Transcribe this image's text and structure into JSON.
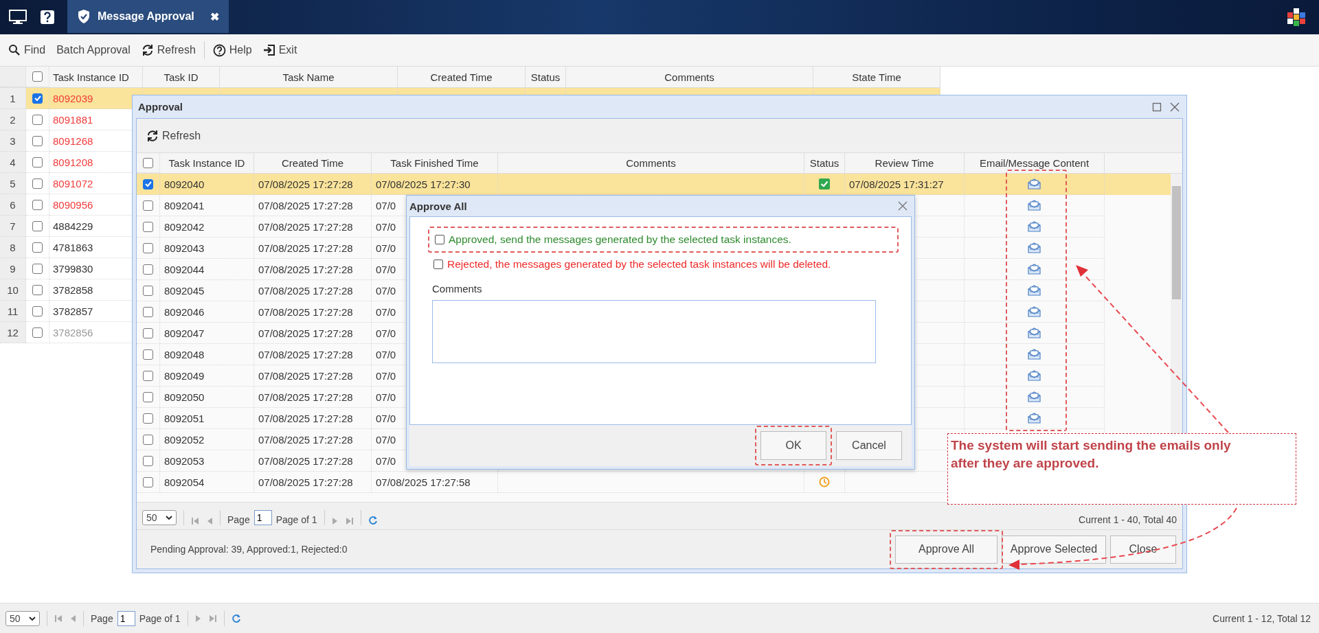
{
  "top_bar": {
    "tab": {
      "title": "Message Approval",
      "close": "✖",
      "selected": true
    }
  },
  "toolbar": [
    {
      "label": "Find",
      "kind": "search",
      "separator_before": false
    },
    {
      "label": "Batch Approval",
      "kind": "plain",
      "separator_before": false
    },
    {
      "label": "Refresh",
      "kind": "refresh",
      "separator_before": false
    },
    {
      "label": "Help",
      "kind": "help",
      "separator_before": true
    },
    {
      "label": "Exit",
      "kind": "exit",
      "separator_before": false
    }
  ],
  "main_grid": {
    "header_checked": false,
    "columns": [
      "Task Instance ID",
      "Task ID",
      "Task Name",
      "Created Time",
      "Status",
      "Comments",
      "State Time"
    ],
    "rows": [
      {
        "number": "1",
        "checked": true,
        "selected": true,
        "task_instance_id": "8092039",
        "color": "#f03a3a"
      },
      {
        "number": "2",
        "checked": false,
        "selected": false,
        "task_instance_id": "8091881",
        "color": "#f03a3a"
      },
      {
        "number": "3",
        "checked": false,
        "selected": false,
        "task_instance_id": "8091268",
        "color": "#f03a3a"
      },
      {
        "number": "4",
        "checked": false,
        "selected": false,
        "task_instance_id": "8091208",
        "color": "#f03a3a"
      },
      {
        "number": "5",
        "checked": false,
        "selected": false,
        "task_instance_id": "8091072",
        "color": "#f03a3a"
      },
      {
        "number": "6",
        "checked": false,
        "selected": false,
        "task_instance_id": "8090956",
        "color": "#f03a3a"
      },
      {
        "number": "7",
        "checked": false,
        "selected": false,
        "task_instance_id": "4884229",
        "color": "#333333"
      },
      {
        "number": "8",
        "checked": false,
        "selected": false,
        "task_instance_id": "4781863",
        "color": "#333333"
      },
      {
        "number": "9",
        "checked": false,
        "selected": false,
        "task_instance_id": "3799830",
        "color": "#333333"
      },
      {
        "number": "10",
        "checked": false,
        "selected": false,
        "task_instance_id": "3782858",
        "color": "#333333"
      },
      {
        "number": "11",
        "checked": false,
        "selected": false,
        "task_instance_id": "3782857",
        "color": "#333333"
      },
      {
        "number": "12",
        "checked": false,
        "selected": false,
        "task_instance_id": "3782856",
        "color": "#999999"
      }
    ]
  },
  "main_pager": {
    "page_size": "50",
    "page_label": "Page",
    "page": "1",
    "page_of": "Page of 1",
    "summary": "Current 1 - 12, Total 12"
  },
  "approval_window": {
    "title": "Approval",
    "refresh": "Refresh",
    "header_checked": false,
    "columns": [
      "Task Instance ID",
      "Created Time",
      "Task Finished Time",
      "Comments",
      "Status",
      "Review Time",
      "Email/Message Content"
    ],
    "rows": [
      {
        "checked": true,
        "selected": true,
        "task_instance_id": "8092040",
        "created_time": "07/08/2025 17:27:28",
        "finished_time": "07/08/2025 17:27:30",
        "kind": "approved",
        "review_time": "07/08/2025 17:31:27",
        "content_icon": true
      },
      {
        "checked": false,
        "selected": false,
        "task_instance_id": "8092041",
        "created_time": "07/08/2025 17:27:28",
        "finished_time": "07/0",
        "content_icon": true
      },
      {
        "checked": false,
        "selected": false,
        "task_instance_id": "8092042",
        "created_time": "07/08/2025 17:27:28",
        "finished_time": "07/0",
        "content_icon": true
      },
      {
        "checked": false,
        "selected": false,
        "task_instance_id": "8092043",
        "created_time": "07/08/2025 17:27:28",
        "finished_time": "07/0",
        "content_icon": true
      },
      {
        "checked": false,
        "selected": false,
        "task_instance_id": "8092044",
        "created_time": "07/08/2025 17:27:28",
        "finished_time": "07/0",
        "content_icon": true
      },
      {
        "checked": false,
        "selected": false,
        "task_instance_id": "8092045",
        "created_time": "07/08/2025 17:27:28",
        "finished_time": "07/0",
        "content_icon": true
      },
      {
        "checked": false,
        "selected": false,
        "task_instance_id": "8092046",
        "created_time": "07/08/2025 17:27:28",
        "finished_time": "07/0",
        "content_icon": true
      },
      {
        "checked": false,
        "selected": false,
        "task_instance_id": "8092047",
        "created_time": "07/08/2025 17:27:28",
        "finished_time": "07/0",
        "content_icon": true
      },
      {
        "checked": false,
        "selected": false,
        "task_instance_id": "8092048",
        "created_time": "07/08/2025 17:27:28",
        "finished_time": "07/0",
        "content_icon": true
      },
      {
        "checked": false,
        "selected": false,
        "task_instance_id": "8092049",
        "created_time": "07/08/2025 17:27:28",
        "finished_time": "07/0",
        "content_icon": true
      },
      {
        "checked": false,
        "selected": false,
        "task_instance_id": "8092050",
        "created_time": "07/08/2025 17:27:28",
        "finished_time": "07/0",
        "content_icon": true
      },
      {
        "checked": false,
        "selected": false,
        "task_instance_id": "8092051",
        "created_time": "07/08/2025 17:27:28",
        "finished_time": "07/0",
        "content_icon": true
      },
      {
        "checked": false,
        "selected": false,
        "task_instance_id": "8092052",
        "created_time": "07/08/2025 17:27:28",
        "finished_time": "07/0",
        "content_icon": false
      },
      {
        "checked": false,
        "selected": false,
        "task_instance_id": "8092053",
        "created_time": "07/08/2025 17:27:28",
        "finished_time": "07/0",
        "content_icon": false
      },
      {
        "checked": false,
        "selected": false,
        "task_instance_id": "8092054",
        "created_time": "07/08/2025 17:27:28",
        "finished_time": "07/08/2025 17:27:58",
        "kind": "pending",
        "content_icon": false
      }
    ],
    "pager": {
      "page_size": "50",
      "page_label": "Page",
      "page": "1",
      "page_of": "Page of 1",
      "summary": "Current 1 - 40, Total 40"
    },
    "summary": "Pending Approval: 39, Approved:1, Rejected:0",
    "buttons": [
      "Approve All",
      "Approve Selected",
      "Close"
    ]
  },
  "approve_all_dialog": {
    "title": "Approve All",
    "options": [
      {
        "kind": "approve",
        "label": "Approved, send the messages generated by the selected task instances.",
        "checked": false
      },
      {
        "kind": "reject",
        "label": "Rejected, the messages generated by the selected task instances will be deleted.",
        "checked": false
      }
    ],
    "comments_label": "Comments",
    "buttons": [
      "OK",
      "Cancel"
    ]
  },
  "annotation": {
    "text": "The system will start sending the emails only after they are approved."
  }
}
